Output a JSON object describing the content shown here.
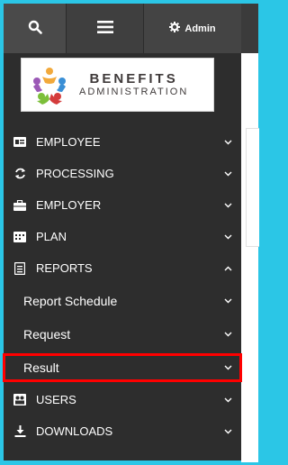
{
  "topbar": {
    "search_icon": "search-icon",
    "menu_icon": "hamburger-menu-icon",
    "admin_icon": "gear-icon",
    "admin_label": "Admin"
  },
  "logo": {
    "line1": "BENEFITS",
    "line2": "ADMINISTRATION"
  },
  "nav": {
    "employee": "EMPLOYEE",
    "processing": "PROCESSING",
    "employer": "EMPLOYER",
    "plan": "PLAN",
    "reports": "REPORTS",
    "report_schedule": "Report Schedule",
    "request": "Request",
    "result": "Result",
    "users": "USERS",
    "downloads": "DOWNLOADS"
  },
  "colors": {
    "accent_border": "#2bc6e6",
    "highlight": "#ff0000",
    "sidebar_bg": "#2d2d2d"
  }
}
